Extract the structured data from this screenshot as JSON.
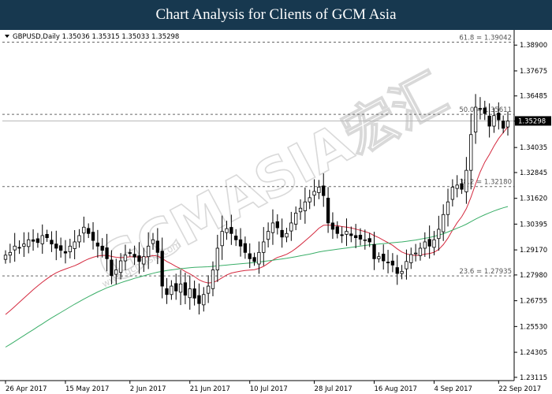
{
  "header": {
    "title": "Chart Analysis for Clients of GCM Asia"
  },
  "watermark": {
    "text": "GCMASIA宏汇",
    "url": "www.gcmasia.com"
  },
  "chart_data": {
    "type": "candlestick",
    "symbol_line": "GBPUSD,Daily  1.35036 1.35315 1.35033 1.35298",
    "last_price": "1.35298",
    "ylim": [
      1.2296,
      1.3962
    ],
    "y_ticks": [
      "1.38900",
      "1.37675",
      "1.36485",
      "1.35290",
      "1.34035",
      "1.32845",
      "1.31620",
      "1.30395",
      "1.29170",
      "1.27980",
      "1.26755",
      "1.25530",
      "1.24305",
      "1.23115"
    ],
    "x_ticks": [
      {
        "label": "26 Apr 2017",
        "index": 0
      },
      {
        "label": "15 May 2017",
        "index": 13
      },
      {
        "label": "2 Jun 2017",
        "index": 27
      },
      {
        "label": "21 Jun 2017",
        "index": 40
      },
      {
        "label": "10 Jul 2017",
        "index": 53
      },
      {
        "label": "28 Jul 2017",
        "index": 67
      },
      {
        "label": "16 Aug 2017",
        "index": 80
      },
      {
        "label": "4 Sep 2017",
        "index": 93
      },
      {
        "label": "22 Sep 2017",
        "index": 107
      }
    ],
    "fib_levels": [
      {
        "label": "61.8 = 1.39042",
        "value": 1.39042
      },
      {
        "label": "50.0 = 1.35611",
        "value": 1.35611
      },
      {
        "label": "38.2 = 1.32180",
        "value": 1.3218
      },
      {
        "label": "23.6 = 1.27935",
        "value": 1.27935
      }
    ],
    "closes": [
      1.2892,
      1.2905,
      1.2935,
      1.2928,
      1.2945,
      1.2965,
      1.2958,
      1.2952,
      1.2985,
      1.2975,
      1.2945,
      1.2925,
      1.2915,
      1.2902,
      1.2935,
      1.2955,
      1.2985,
      1.3025,
      1.2995,
      1.2962,
      1.2935,
      1.2915,
      1.2875,
      1.2795,
      1.2822,
      1.2865,
      1.2892,
      1.2902,
      1.2883,
      1.2862,
      1.2885,
      1.2935,
      1.2965,
      1.2905,
      1.2745,
      1.2705,
      1.2745,
      1.2722,
      1.2755,
      1.2702,
      1.2732,
      1.2688,
      1.2662,
      1.2705,
      1.2745,
      1.2822,
      1.2925,
      1.3005,
      1.3018,
      1.2995,
      1.2965,
      1.2935,
      1.2905,
      1.2875,
      1.2862,
      1.2905,
      1.2955,
      1.3005,
      1.3045,
      1.3022,
      1.2978,
      1.2995,
      1.3045,
      1.3092,
      1.3115,
      1.3145,
      1.3165,
      1.3195,
      1.3215,
      1.3175,
      1.3045,
      1.3015,
      1.2995,
      1.2985,
      1.3005,
      1.2985,
      1.2975,
      1.2968,
      1.2965,
      1.2955,
      1.2875,
      1.2885,
      1.2865,
      1.2858,
      1.2845,
      1.2805,
      1.2815,
      1.2862,
      1.2895,
      1.2902,
      1.2925,
      1.2955,
      1.2935,
      1.2965,
      1.3015,
      1.3085,
      1.3145,
      1.3215,
      1.3225,
      1.3205,
      1.3295,
      1.3465,
      1.3595,
      1.3585,
      1.3565,
      1.3505,
      1.3555,
      1.3535,
      1.3495,
      1.3529
    ],
    "series": [
      {
        "name": "MA",
        "color": "#d42a3f",
        "values": [
          1.261,
          1.2628,
          1.2648,
          1.2668,
          1.2688,
          1.2708,
          1.2728,
          1.2746,
          1.2764,
          1.278,
          1.2795,
          1.2808,
          1.2818,
          1.2826,
          1.2834,
          1.2842,
          1.2852,
          1.2864,
          1.2874,
          1.2882,
          1.2888,
          1.2891,
          1.2891,
          1.2886,
          1.2882,
          1.288,
          1.2882,
          1.2884,
          1.2884,
          1.2883,
          1.2882,
          1.2885,
          1.289,
          1.2888,
          1.2876,
          1.2862,
          1.2851,
          1.2838,
          1.2828,
          1.2814,
          1.2803,
          1.279,
          1.2775,
          1.2765,
          1.276,
          1.2762,
          1.2771,
          1.2785,
          1.2798,
          1.2807,
          1.2812,
          1.2816,
          1.2819,
          1.2821,
          1.2823,
          1.2829,
          1.2839,
          1.2853,
          1.2869,
          1.2881,
          1.2888,
          1.2896,
          1.2908,
          1.2924,
          1.2941,
          1.296,
          1.2979,
          1.2999,
          1.302,
          1.3034,
          1.3035,
          1.3034,
          1.3032,
          1.3028,
          1.3025,
          1.3021,
          1.3016,
          1.301,
          1.3004,
          1.2997,
          1.2985,
          1.2975,
          1.2963,
          1.2951,
          1.2939,
          1.2922,
          1.2907,
          1.2898,
          1.2893,
          1.289,
          1.2892,
          1.2897,
          1.29,
          1.2906,
          1.2919,
          1.2942,
          1.2973,
          1.3011,
          1.3046,
          1.3075,
          1.3113,
          1.3167,
          1.323,
          1.3287,
          1.3334,
          1.337,
          1.3411,
          1.3446,
          1.3474,
          1.3502
        ]
      },
      {
        "name": "MA",
        "color": "#3aae68",
        "values": [
          1.2455,
          1.2468,
          1.2482,
          1.2496,
          1.251,
          1.2524,
          1.2538,
          1.2552,
          1.2566,
          1.258,
          1.2594,
          1.2607,
          1.262,
          1.2633,
          1.2646,
          1.2659,
          1.2671,
          1.2683,
          1.2695,
          1.2706,
          1.2717,
          1.2727,
          1.2737,
          1.2745,
          1.2753,
          1.2761,
          1.2768,
          1.2775,
          1.2782,
          1.2788,
          1.2794,
          1.28,
          1.2806,
          1.2811,
          1.2815,
          1.2819,
          1.2822,
          1.2825,
          1.2828,
          1.283,
          1.2832,
          1.2834,
          1.2835,
          1.2836,
          1.2837,
          1.2839,
          1.2841,
          1.2843,
          1.2845,
          1.2847,
          1.2849,
          1.2851,
          1.2853,
          1.2855,
          1.2857,
          1.2859,
          1.2862,
          1.2865,
          1.2868,
          1.2871,
          1.2874,
          1.2877,
          1.2881,
          1.2885,
          1.2889,
          1.2893,
          1.2897,
          1.2902,
          1.2907,
          1.2911,
          1.2914,
          1.2917,
          1.292,
          1.2923,
          1.2926,
          1.2929,
          1.2932,
          1.2935,
          1.2938,
          1.2941,
          1.2943,
          1.2945,
          1.2947,
          1.2949,
          1.2951,
          1.2953,
          1.2955,
          1.2958,
          1.2961,
          1.2964,
          1.2968,
          1.2972,
          1.2976,
          1.2981,
          1.2987,
          1.2994,
          1.3002,
          1.3011,
          1.302,
          1.3029,
          1.3039,
          1.3051,
          1.3063,
          1.3074,
          1.3084,
          1.3093,
          1.3102,
          1.311,
          1.3117,
          1.3123
        ]
      }
    ],
    "xlabel": "",
    "ylabel": "",
    "grid": false
  }
}
